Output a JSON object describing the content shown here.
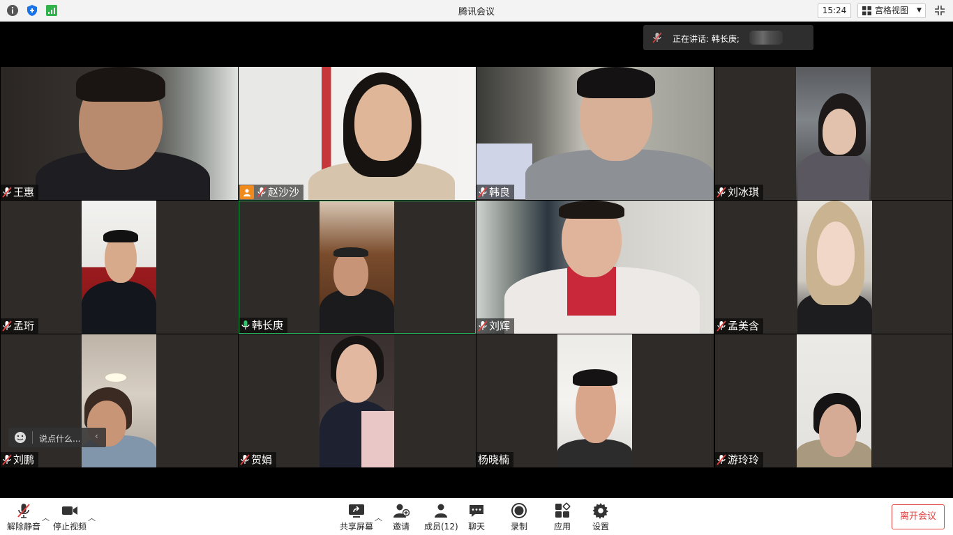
{
  "window": {
    "title": "腾讯会议",
    "clock": "15:24",
    "view_mode": "宫格视图"
  },
  "speaking_banner": {
    "text": "正在讲话: 韩长庚;"
  },
  "participants": [
    {
      "name": "王惠",
      "mic": "muted"
    },
    {
      "name": "赵沙沙",
      "mic": "muted",
      "host": true
    },
    {
      "name": "韩良",
      "mic": "muted"
    },
    {
      "name": "刘冰琪",
      "mic": "muted"
    },
    {
      "name": "孟珩",
      "mic": "muted"
    },
    {
      "name": "韩长庚",
      "mic": "speaking",
      "active": true
    },
    {
      "name": "刘辉",
      "mic": "muted"
    },
    {
      "name": "孟美含",
      "mic": "muted"
    },
    {
      "name": "刘鹏",
      "mic": "muted"
    },
    {
      "name": "贺娟",
      "mic": "muted"
    },
    {
      "name": "杨晓楠",
      "mic": "none"
    },
    {
      "name": "游玲玲",
      "mic": "muted"
    }
  ],
  "chat_prompt": {
    "placeholder": "说点什么..."
  },
  "toolbar": {
    "unmute": "解除静音",
    "stop_video": "停止视频",
    "share_screen": "共享屏幕",
    "invite": "邀请",
    "members": "成员(12)",
    "chat": "聊天",
    "record": "录制",
    "apps": "应用",
    "settings": "设置",
    "leave": "离开会议"
  },
  "colors": {
    "active_border": "#2fc36a",
    "host_badge": "#f08a1d",
    "leave": "#e0413f",
    "muted_mic": "#e0413f"
  }
}
